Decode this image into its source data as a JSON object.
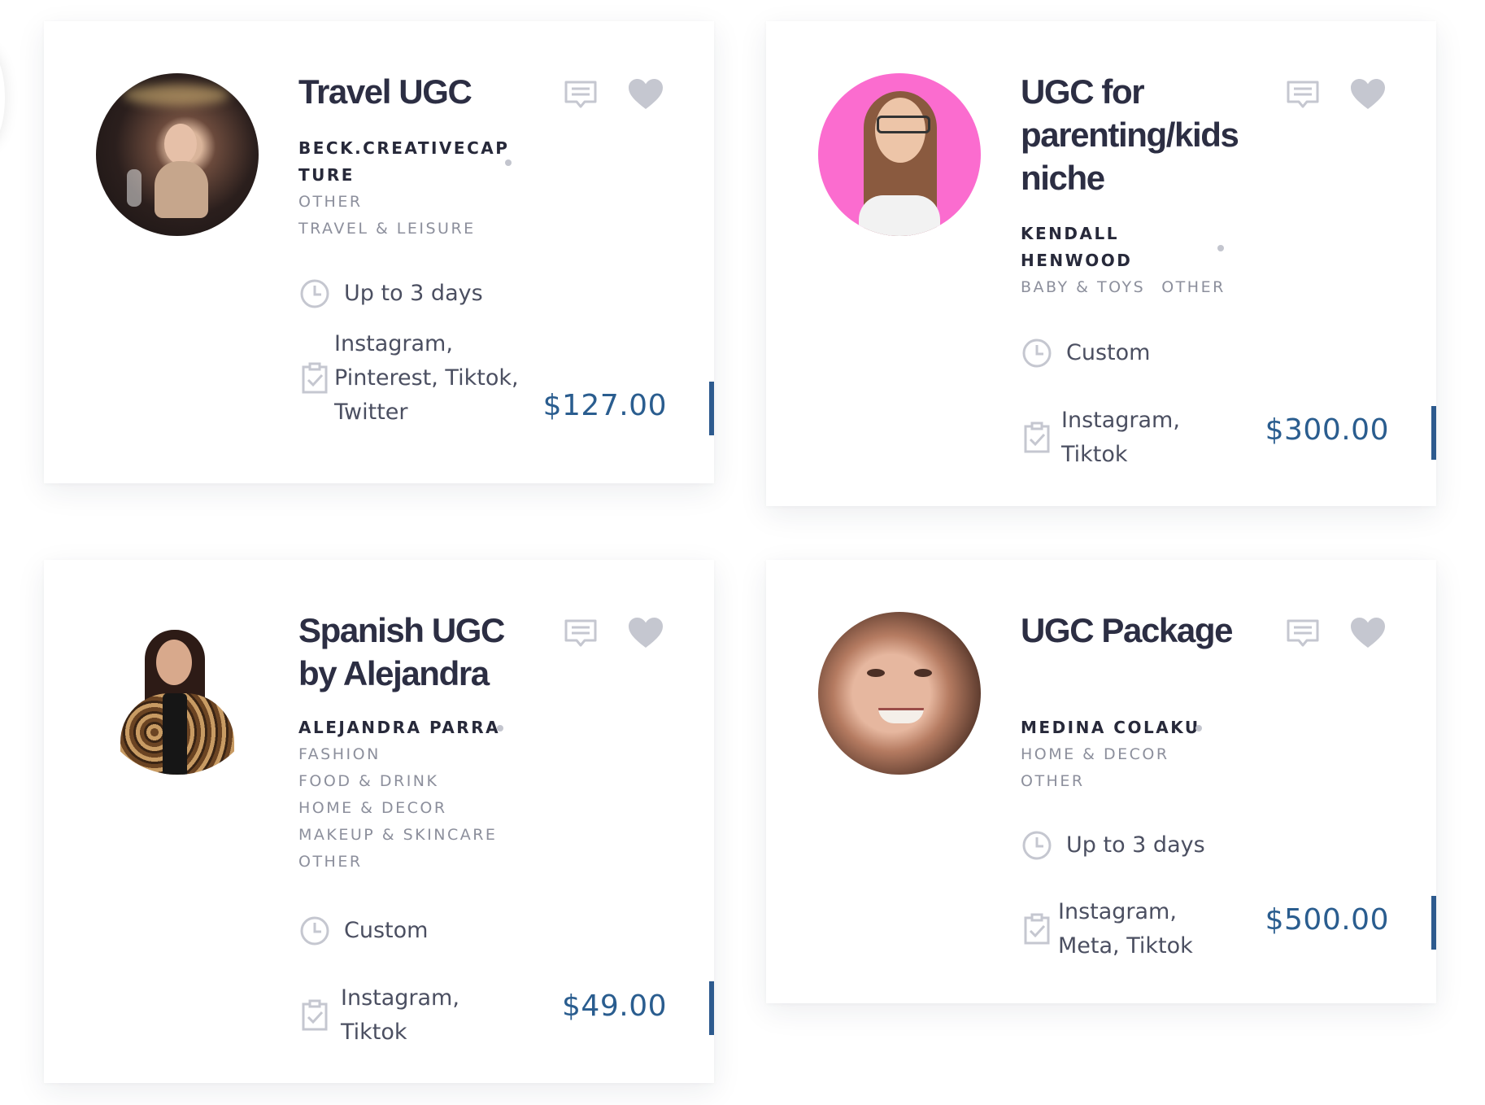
{
  "cards": [
    {
      "title": "Travel UGC",
      "creator": "BECK.CREATIVECAPTURE",
      "categories": [
        "OTHER",
        "TRAVEL & LEISURE"
      ],
      "delivery": "Up to 3 days",
      "platforms": "Instagram, Pinterest, Tiktok, Twitter",
      "price": "$127.00"
    },
    {
      "title": "UGC for parenting/kids niche",
      "creator": "KENDALL HENWOOD",
      "categories": [
        "BABY & TOYS",
        "OTHER"
      ],
      "delivery": "Custom",
      "platforms": "Instagram, Tiktok",
      "price": "$300.00"
    },
    {
      "title": "Spanish UGC by Alejandra",
      "creator": "ALEJANDRA PARRA",
      "categories": [
        "FASHION",
        "FOOD & DRINK",
        "HOME & DECOR",
        "MAKEUP & SKINCARE",
        "OTHER"
      ],
      "delivery": "Custom",
      "platforms": "Instagram, Tiktok",
      "price": "$49.00"
    },
    {
      "title": "UGC Package",
      "creator": "MEDINA COLAKU",
      "categories": [
        "HOME & DECOR",
        "OTHER"
      ],
      "delivery": "Up to 3 days",
      "platforms": "Instagram, Meta, Tiktok",
      "price": "$500.00"
    }
  ],
  "icons": {
    "message": "message-icon",
    "favorite": "heart-icon",
    "delivery": "clock-icon",
    "platforms": "clipboard-check-icon"
  },
  "colors": {
    "price": "#2a5d8f",
    "accent": "#2d5a8e",
    "icon": "#c5c7d0",
    "title": "#2c2e43"
  }
}
